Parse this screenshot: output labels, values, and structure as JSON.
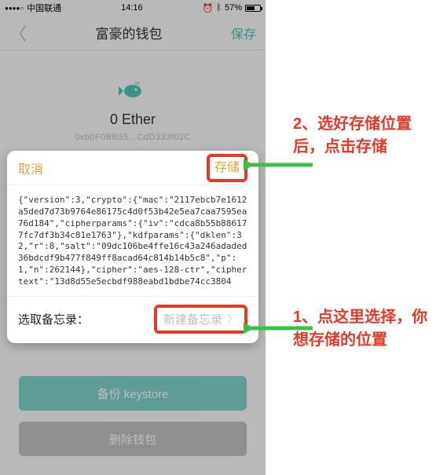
{
  "status": {
    "signal_dots": "●●●●○",
    "carrier": "中国联通",
    "time": "14:16",
    "battery_pct": "57%"
  },
  "nav": {
    "title": "富豪的钱包",
    "save": "保存"
  },
  "wallet": {
    "balance": "0 Ether",
    "address": "0xb0F0BB35...CdD333f02C"
  },
  "sheet": {
    "cancel": "取消",
    "store": "存储",
    "keystore": "{\"version\":3,\"crypto\":{\"mac\":\"2117ebcb7e1612a5ded7d73b9764e86175c4d0f53b42e5ea7caa7595ea76d184\",\"cipherparams\":{\"iv\":\"cdca8b55b886177fc7df3b34c81e1763\"},\"kdfparams\":{\"dklen\":32,\"r\":8,\"salt\":\"09dc106be4ffe16c43a246adaded36bdcdf9b477f849ff8acad64c814b14b5c8\",\"p\":1,\"n\":262144},\"cipher\":\"aes-128-ctr\",\"ciphertext\":\"13d8d55e5ecbdf988eabd1bdbe74cc3804",
    "row_label": "选取备忘录：",
    "memo_placeholder": "新建备忘录"
  },
  "buttons": {
    "backup": "备份 keystore",
    "delete": "删除钱包"
  },
  "annotations": {
    "a1": "2、选好存储位置后，点击存储",
    "a2": "1、点这里选择，你想存储的位置"
  },
  "colors": {
    "highlight": "#e23a2a",
    "teal": "#4bc3b5",
    "gold": "#d7a63a"
  }
}
